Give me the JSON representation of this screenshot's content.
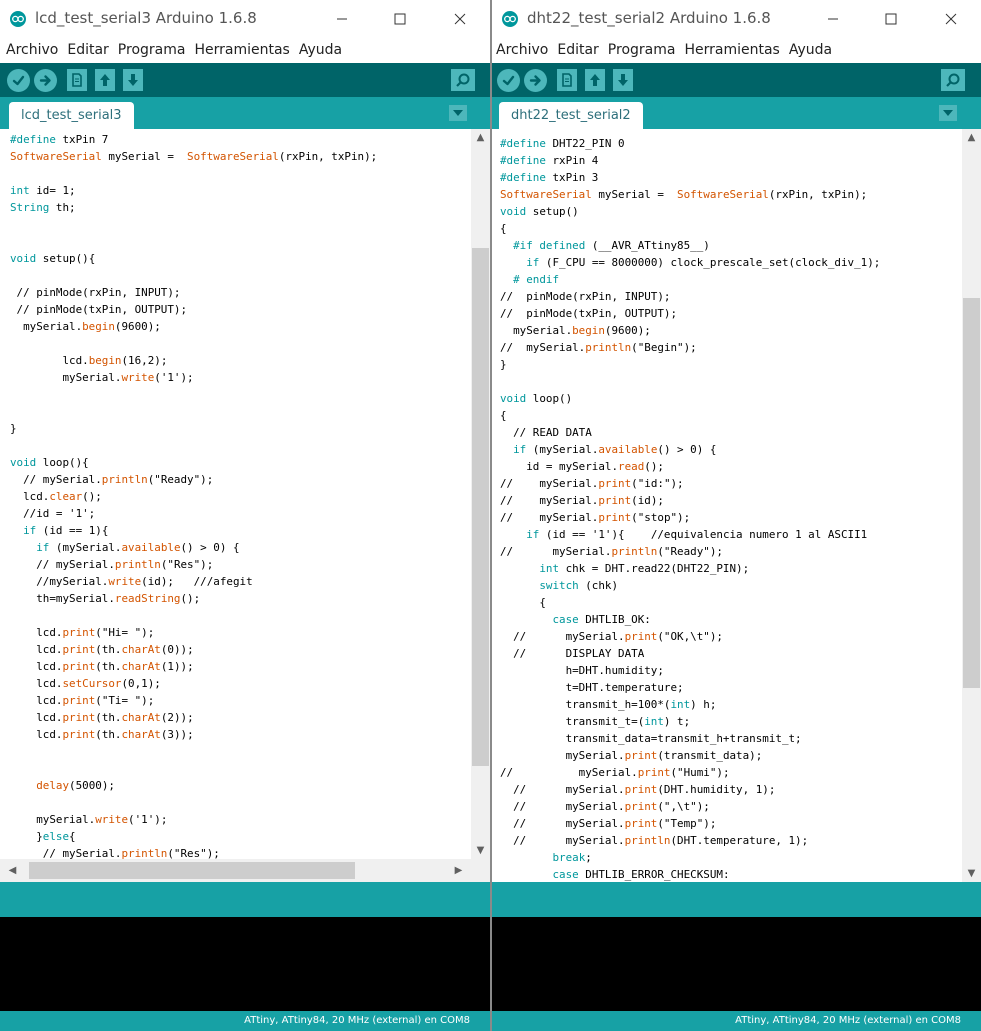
{
  "left": {
    "title": "lcd_test_serial3 Arduino 1.6.8",
    "menu": [
      "Archivo",
      "Editar",
      "Programa",
      "Herramientas",
      "Ayuda"
    ],
    "tab": "lcd_test_serial3",
    "status": "ATtiny, ATtiny84, 20 MHz (external) en COM8",
    "code": [
      "#define txPin 7",
      "SoftwareSerial mySerial =  SoftwareSerial(rxPin, txPin);",
      "",
      "int id= 1;",
      "String th;",
      "",
      "",
      "void setup(){",
      "",
      " // pinMode(rxPin, INPUT);",
      " // pinMode(txPin, OUTPUT);",
      "  mySerial.begin(9600);",
      "",
      "        lcd.begin(16,2);",
      "        mySerial.write('1');",
      "",
      "",
      "}",
      "",
      "void loop(){",
      "  // mySerial.println(\"Ready\");",
      "  lcd.clear();",
      "  //id = '1';",
      "  if (id == 1){",
      "    if (mySerial.available() > 0) {",
      "    // mySerial.println(\"Res\");",
      "    //mySerial.write(id);   ///afegit",
      "    th=mySerial.readString();",
      "",
      "    lcd.print(\"Hi= \");",
      "    lcd.print(th.charAt(0));",
      "    lcd.print(th.charAt(1));",
      "    lcd.setCursor(0,1);",
      "    lcd.print(\"Ti= \");",
      "    lcd.print(th.charAt(2));",
      "    lcd.print(th.charAt(3));",
      "",
      "",
      "    delay(5000);",
      "",
      "    mySerial.write('1');",
      "    }else{",
      "     // mySerial.println(\"Res\");"
    ]
  },
  "right": {
    "title": "dht22_test_serial2 Arduino 1.6.8",
    "menu": [
      "Archivo",
      "Editar",
      "Programa",
      "Herramientas",
      "Ayuda"
    ],
    "tab": "dht22_test_serial2",
    "status": "ATtiny, ATtiny84, 20 MHz (external) en COM8",
    "code": [
      "#define DHT22_PIN 0",
      "#define rxPin 4",
      "#define txPin 3",
      "SoftwareSerial mySerial =  SoftwareSerial(rxPin, txPin);",
      "void setup()",
      "{",
      "  #if defined (__AVR_ATtiny85__)",
      "    if (F_CPU == 8000000) clock_prescale_set(clock_div_1);",
      "  # endif",
      "//  pinMode(rxPin, INPUT);",
      "//  pinMode(txPin, OUTPUT);",
      "  mySerial.begin(9600);",
      "//  mySerial.println(\"Begin\");",
      "}",
      "",
      "void loop()",
      "{",
      "  // READ DATA",
      "  if (mySerial.available() > 0) {",
      "    id = mySerial.read();",
      "//    mySerial.print(\"id:\");",
      "//    mySerial.print(id);",
      "//    mySerial.print(\"stop\");",
      "    if (id == '1'){    //equivalencia numero 1 al ASCII1",
      "//      mySerial.println(\"Ready\");",
      "      int chk = DHT.read22(DHT22_PIN);",
      "      switch (chk)",
      "      {",
      "        case DHTLIB_OK:",
      "  //      mySerial.print(\"OK,\\t\");",
      "  //      DISPLAY DATA",
      "          h=DHT.humidity;",
      "          t=DHT.temperature;",
      "          transmit_h=100*(int) h;",
      "          transmit_t=(int) t;",
      "          transmit_data=transmit_h+transmit_t;",
      "          mySerial.print(transmit_data);",
      "//          mySerial.print(\"Humi\");",
      "  //      mySerial.print(DHT.humidity, 1);",
      "  //      mySerial.print(\",\\t\");",
      "  //      mySerial.print(\"Temp\");",
      "  //      mySerial.println(DHT.temperature, 1);",
      "        break;",
      "        case DHTLIB_ERROR_CHECKSUM:"
    ]
  },
  "keywords": [
    "#define",
    "#if",
    "# endif",
    "defined",
    "void",
    "int",
    "String",
    "if",
    "else",
    "switch",
    "case",
    "break"
  ],
  "functions": [
    "SoftwareSerial",
    "begin",
    "write",
    "print",
    "println",
    "available",
    "read",
    "readString",
    "clear",
    "setCursor",
    "charAt",
    "delay"
  ],
  "colors": {
    "teal_dark": "#006468",
    "teal": "#17a1a5",
    "keyword": "#00979c",
    "function": "#d35400"
  }
}
